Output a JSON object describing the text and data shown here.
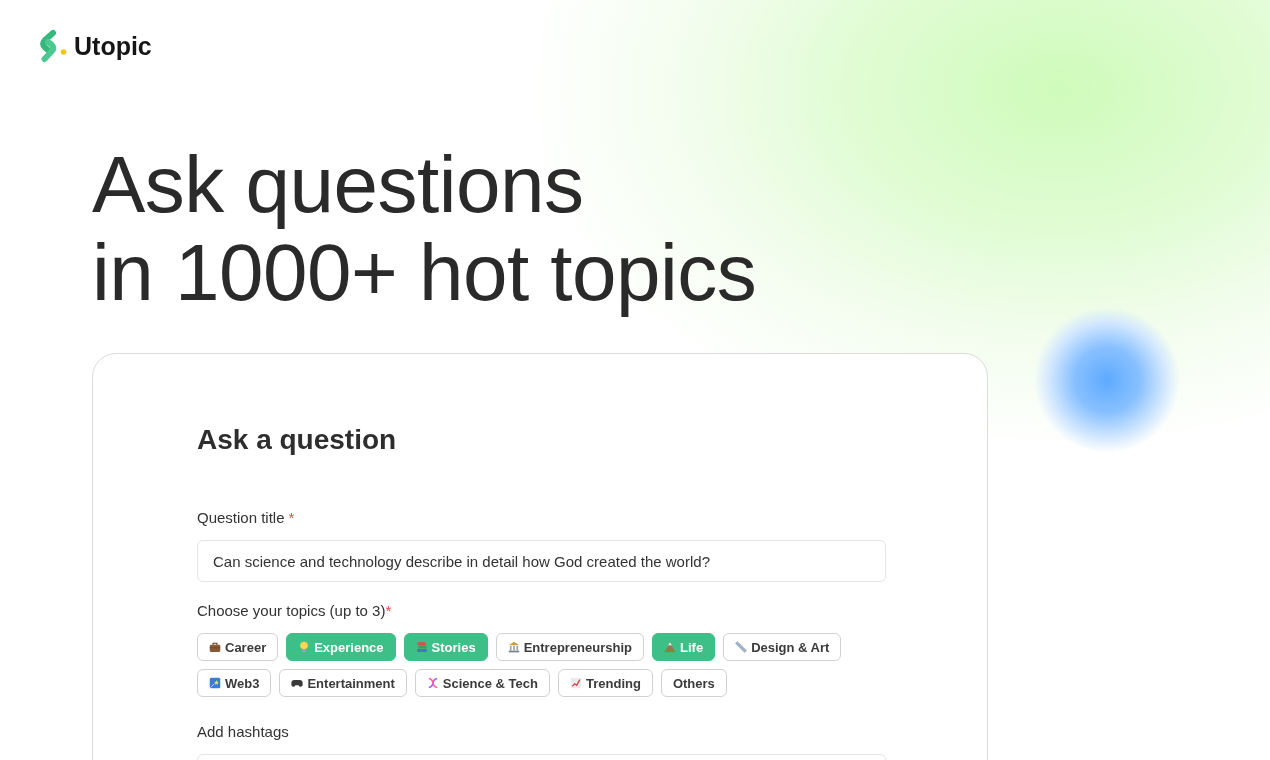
{
  "brand": {
    "name": "Utopic"
  },
  "hero": {
    "lines": [
      "Ask questions",
      "in 1000+ hot topics"
    ]
  },
  "form": {
    "title": "Ask a question",
    "fields": [
      {
        "kind": "text",
        "label": "Question title",
        "required_mark": "*",
        "value": "Can science and technology describe in detail how God created the world?"
      },
      {
        "kind": "topics",
        "label": "Choose your topics (up to 3)",
        "required_mark": "*",
        "chips": [
          {
            "label": "Career",
            "selected": false
          },
          {
            "label": "Experience",
            "selected": true
          },
          {
            "label": "Stories",
            "selected": true
          },
          {
            "label": "Entrepreneurship",
            "selected": false
          },
          {
            "label": "Life",
            "selected": true
          },
          {
            "label": "Design & Art",
            "selected": false
          },
          {
            "label": "Web3",
            "selected": false
          },
          {
            "label": "Entertainment",
            "selected": false
          },
          {
            "label": "Science & Tech",
            "selected": false
          },
          {
            "label": "Trending",
            "selected": false
          },
          {
            "label": "Others",
            "selected": false
          }
        ]
      },
      {
        "kind": "text",
        "label": "Add hashtags"
      }
    ]
  }
}
